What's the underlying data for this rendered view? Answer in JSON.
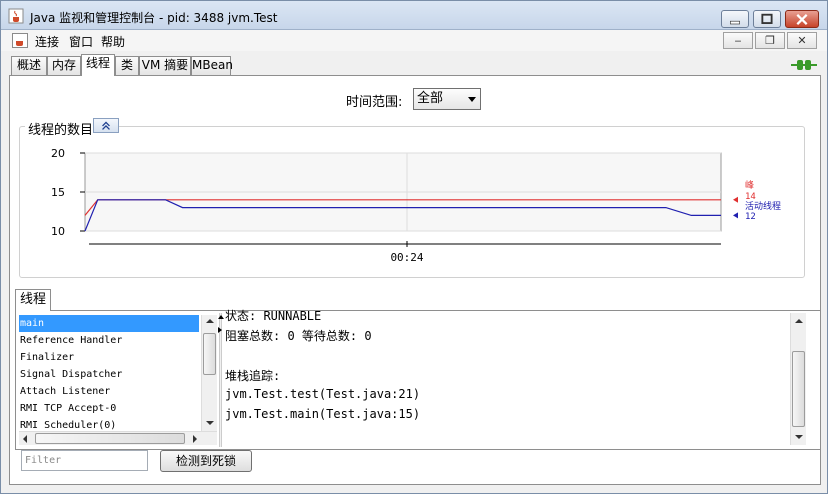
{
  "window": {
    "title": "Java 监视和管理控制台 - pid: 3488 jvm.Test"
  },
  "menu": {
    "items": [
      "连接",
      "窗口",
      "帮助"
    ],
    "mdi_min": "‒",
    "mdi_restore": "❐",
    "mdi_close": "✕"
  },
  "tabs": [
    "概述",
    "内存",
    "线程",
    "类",
    "VM 摘要",
    "MBean"
  ],
  "active_tab": "线程",
  "time_range": {
    "label": "时间范围:",
    "selected": "全部"
  },
  "chart_group": {
    "title": "线程的数目"
  },
  "chart_data": {
    "type": "line",
    "x_tick_label": "00:24",
    "ylim": [
      10,
      20
    ],
    "yticks": [
      10,
      15,
      20
    ],
    "grid": true,
    "legend_placement": "right",
    "series": [
      {
        "name": "峰",
        "color": "#e03030",
        "current": 14,
        "x": [
          0,
          3,
          22,
          150
        ],
        "values": [
          12,
          14,
          14,
          14
        ]
      },
      {
        "name": "活动线程",
        "color": "#2020b0",
        "current": 12,
        "x": [
          0,
          3,
          19,
          23,
          137,
          143,
          150
        ],
        "values": [
          10,
          14,
          14,
          13,
          13,
          12,
          12
        ]
      }
    ],
    "x_range": [
      0,
      150
    ]
  },
  "threads_tab": {
    "label": "线程",
    "list": [
      "main",
      "Reference Handler",
      "Finalizer",
      "Signal Dispatcher",
      "Attach Listener",
      "RMI TCP Accept-0",
      "RMI Scheduler(0)"
    ],
    "selected": "main",
    "detail_lines": [
      "状态:  RUNNABLE",
      "阻塞总数: 0   等待总数:  0",
      "",
      "堆栈追踪:",
      "jvm.Test.test(Test.java:21)",
      "jvm.Test.main(Test.java:15)"
    ],
    "filter_placeholder": "Filter",
    "deadlock_button": "检测到死锁"
  },
  "colors": {
    "accent_selection": "#3399ff",
    "close_button": "#c7432a",
    "connection_icon": "#3a9a2a"
  },
  "icons": [
    "java-cup-icon",
    "minimize-icon",
    "maximize-icon",
    "close-icon",
    "connection-plug-icon",
    "collapse-up-icon"
  ]
}
